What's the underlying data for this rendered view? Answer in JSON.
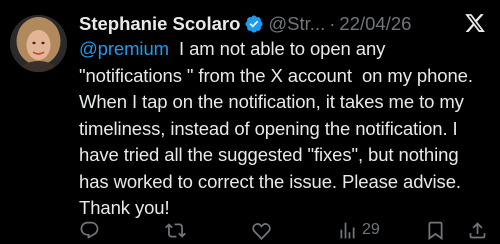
{
  "tweet": {
    "display_name": "Stephanie Scolaro",
    "handle": "@Str...",
    "separator": "·",
    "date": "22/04/26",
    "mention": "@premium",
    "body": "  I am not able to open any \"notifications \" from the X account  on my phone. When I tap on the notification, it takes me to my timeliness, instead of opening the notification. I have tried all the suggested \"fixes\", but nothing has worked to correct the issue. Please advise. Thank you!",
    "views_count": "29"
  },
  "icons": {
    "verified": "verified-badge-icon",
    "platform_logo": "x-logo-icon",
    "reply": "reply-icon",
    "retweet": "retweet-icon",
    "like": "heart-icon",
    "views": "views-chart-icon",
    "bookmark": "bookmark-icon",
    "share": "share-icon"
  },
  "colors": {
    "background": "#000000",
    "text": "#e7e9ea",
    "secondary_text": "#71767b",
    "accent": "#1d9bf0"
  }
}
